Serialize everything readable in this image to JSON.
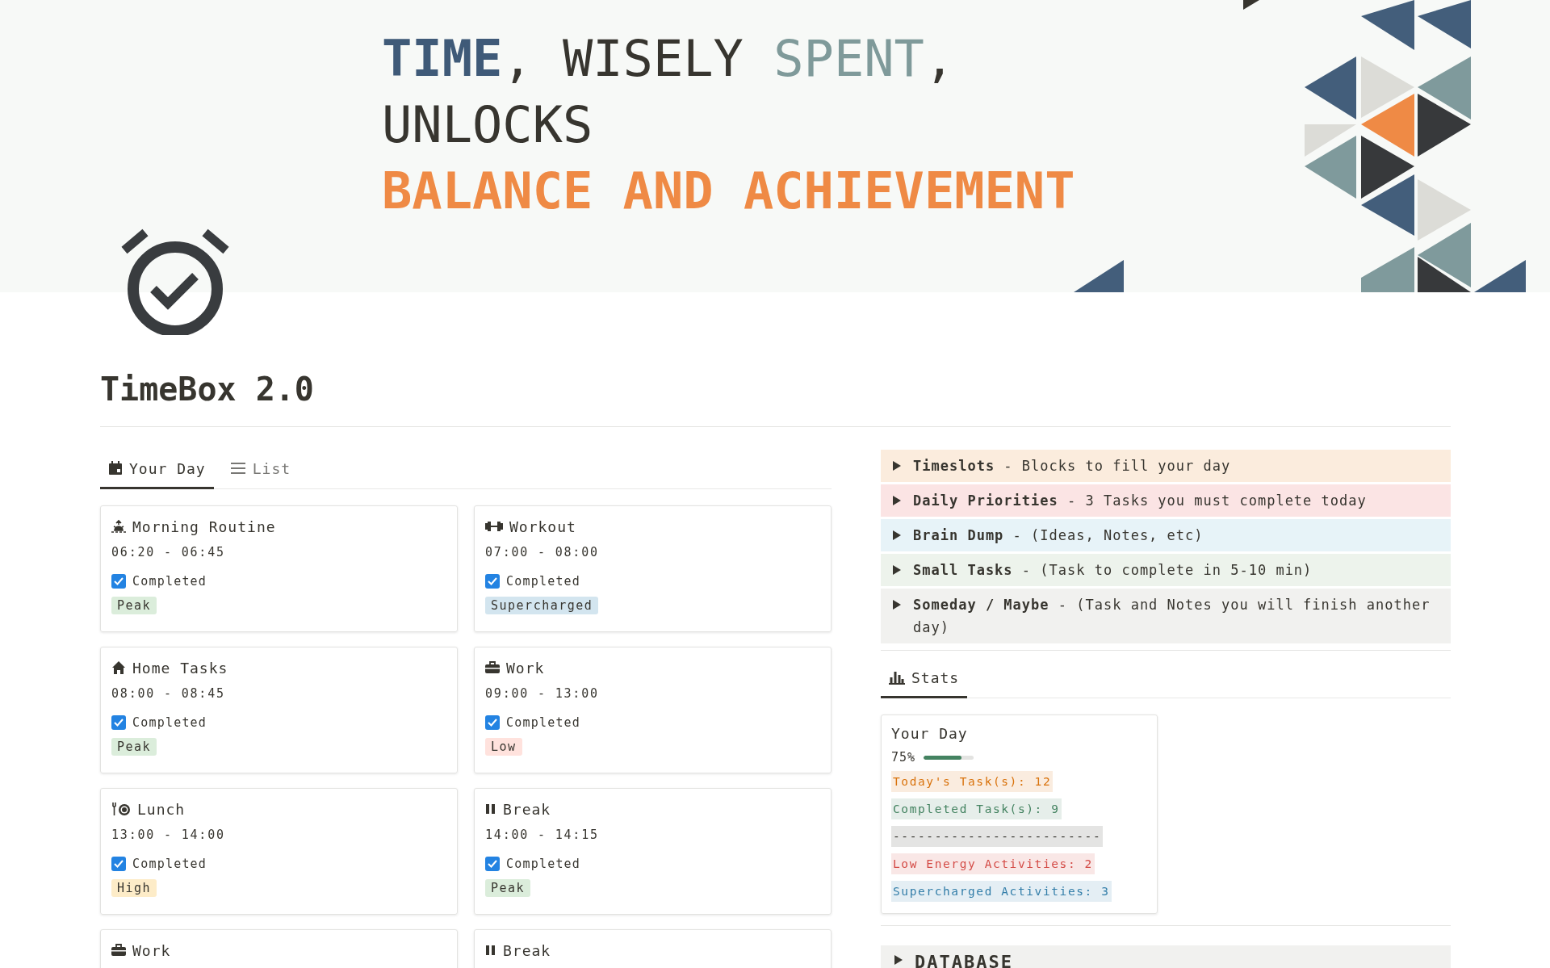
{
  "banner": {
    "lines": [
      [
        {
          "text": "TIME",
          "kind": "strong"
        },
        {
          "text": ", WISELY ",
          "kind": "plain"
        },
        {
          "text": "SPENT",
          "kind": "muted"
        },
        {
          "text": ",",
          "kind": "plain"
        }
      ],
      [
        {
          "text": "UNLOCKS",
          "kind": "plain"
        }
      ],
      [
        {
          "text": "BALANCE AND ACHIEVEMENT",
          "kind": "highlight"
        }
      ]
    ]
  },
  "page": {
    "title": "TimeBox 2.0"
  },
  "day_view": {
    "tabs": [
      {
        "label": "Your Day",
        "kind": "calendar",
        "selected": true
      },
      {
        "label": "List",
        "kind": "list",
        "selected": false
      }
    ],
    "cards": [
      {
        "title": "Morning Routine",
        "kind": "sunrise",
        "time": "06:20 - 06:45",
        "status": "Completed",
        "completed": true,
        "energy": "Peak",
        "color": "#dbeddb"
      },
      {
        "title": "Workout",
        "kind": "dumbbell",
        "time": "07:00 - 08:00",
        "status": "Completed",
        "completed": true,
        "energy": "Supercharged",
        "color": "#d3e5ef"
      },
      {
        "title": "Home Tasks",
        "kind": "home",
        "time": "08:00 - 08:45",
        "status": "Completed",
        "completed": true,
        "energy": "Peak",
        "color": "#dbeddb"
      },
      {
        "title": "Work",
        "kind": "briefcase",
        "time": "09:00 - 13:00",
        "status": "Completed",
        "completed": true,
        "energy": "Low",
        "color": "#ffe2dd"
      },
      {
        "title": "Lunch",
        "kind": "meal",
        "time": "13:00 - 14:00",
        "status": "Completed",
        "completed": true,
        "energy": "High",
        "color": "#fdecc8"
      },
      {
        "title": "Break",
        "kind": "pause",
        "time": "14:00 - 14:15",
        "status": "Completed",
        "completed": true,
        "energy": "Peak",
        "color": "#dbeddb"
      },
      {
        "title": "Work",
        "kind": "briefcase"
      },
      {
        "title": "Break",
        "kind": "pause"
      }
    ]
  },
  "toggles": [
    {
      "text": "**Timeslots** - Blocks to fill your day",
      "color": "#fbecdd",
      "expanded": false
    },
    {
      "text": "**Daily Priorities** - 3 Tasks you must complete today",
      "color": "#fbe4e4",
      "expanded": false
    },
    {
      "text": "**Brain Dump** - (Ideas, Notes, etc)",
      "color": "#e7f3f8",
      "expanded": false
    },
    {
      "text": "**Small Tasks** - (Task to complete in 5-10 min)",
      "color": "#edf3ec",
      "expanded": false
    },
    {
      "text": "**Someday / Maybe** - (Task and Notes you will finish another day)",
      "color": "#f1f1ef",
      "expanded": false
    }
  ],
  "stats": {
    "tabs": [
      {
        "label": "Stats",
        "kind": "chart",
        "selected": true
      }
    ],
    "card": {
      "title": "Your Day",
      "percent": "75%",
      "level": 0.75,
      "lines": [
        {
          "text": "Today's Task(s): 12",
          "color": "#d9730d"
        },
        {
          "text": "Completed Task(s): 9",
          "color": "#448361"
        },
        {
          "text": "-------------------------",
          "color": "#37352f"
        },
        {
          "text": "Low Energy Activities: 2",
          "color": "#d44c47"
        },
        {
          "text": "Supercharged Activities: 3",
          "color": "#337ea9"
        }
      ]
    }
  },
  "database": {
    "title": "DATABASE",
    "expanded": false
  }
}
